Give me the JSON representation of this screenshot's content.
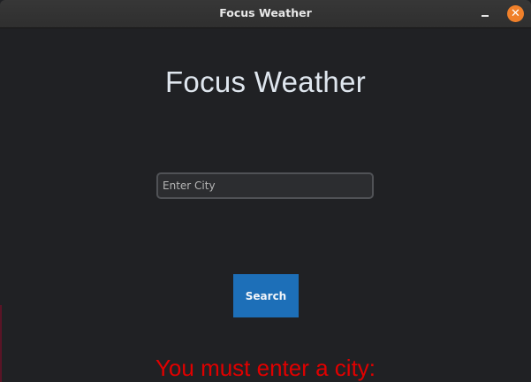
{
  "window": {
    "title": "Focus Weather",
    "minimize_icon": "minimize-icon",
    "close_icon": "close-icon",
    "close_glyph": "✕"
  },
  "main": {
    "heading": "Focus Weather",
    "city_input": {
      "placeholder": "Enter City",
      "value": ""
    },
    "search_label": "Search",
    "error_message": "You must enter a city:"
  },
  "colors": {
    "background": "#202124",
    "accent": "#1d6fb8",
    "error": "#e00000",
    "close_button": "#f0802a"
  }
}
